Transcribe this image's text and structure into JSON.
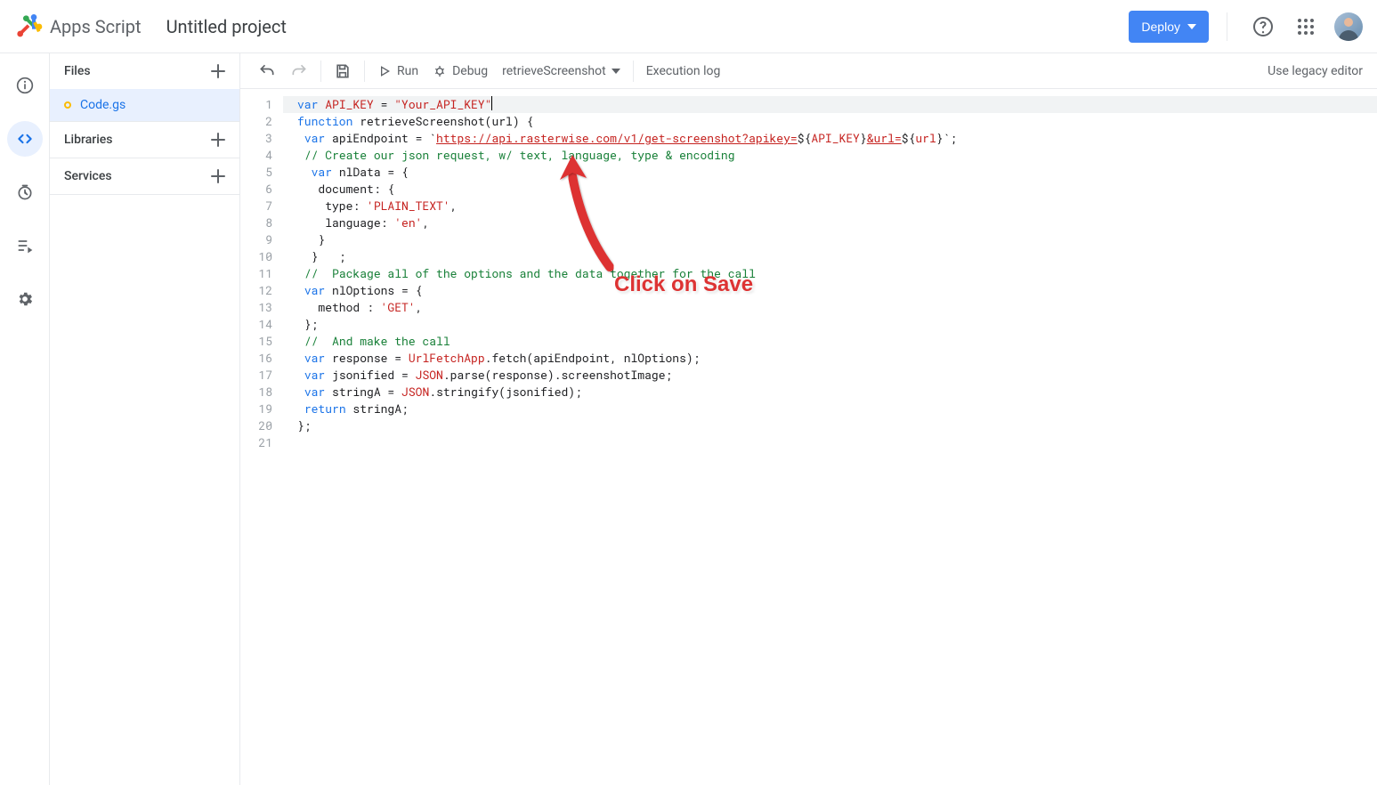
{
  "header": {
    "brand": "Apps Script",
    "project_title": "Untitled project",
    "deploy_label": "Deploy"
  },
  "sidebar": {
    "files_label": "Files",
    "libraries_label": "Libraries",
    "services_label": "Services",
    "file_name": "Code.gs"
  },
  "toolbar": {
    "run_label": "Run",
    "debug_label": "Debug",
    "function_selected": "retrieveScreenshot",
    "execution_log_label": "Execution log",
    "legacy_label": "Use legacy editor"
  },
  "annotation": {
    "text": "Click on Save"
  },
  "code": {
    "lines": [
      {
        "n": 1,
        "segs": [
          {
            "t": "kw",
            "v": "var"
          },
          {
            "t": "",
            "v": " "
          },
          {
            "t": "tvar",
            "v": "API_KEY"
          },
          {
            "t": "",
            "v": " = "
          },
          {
            "t": "str",
            "v": "\"Your_API_KEY\""
          }
        ]
      },
      {
        "n": 2,
        "segs": [
          {
            "t": "kw",
            "v": "function"
          },
          {
            "t": "",
            "v": " retrieveScreenshot(url) {"
          }
        ]
      },
      {
        "n": 3,
        "segs": [
          {
            "t": "",
            "v": " "
          },
          {
            "t": "kw",
            "v": "var"
          },
          {
            "t": "",
            "v": " apiEndpoint = `"
          },
          {
            "t": "url",
            "v": "https://api.rasterwise.com/v1/get-screenshot?apikey="
          },
          {
            "t": "",
            "v": "${"
          },
          {
            "t": "tvar",
            "v": "API_KEY"
          },
          {
            "t": "",
            "v": "}"
          },
          {
            "t": "url",
            "v": "&url="
          },
          {
            "t": "",
            "v": "${"
          },
          {
            "t": "tvar",
            "v": "url"
          },
          {
            "t": "",
            "v": "}"
          },
          {
            "t": "",
            "v": "`;"
          }
        ]
      },
      {
        "n": 4,
        "segs": [
          {
            "t": "",
            "v": " "
          },
          {
            "t": "cmt",
            "v": "// Create our json request, w/ text, language, type & encoding"
          }
        ]
      },
      {
        "n": 5,
        "segs": [
          {
            "t": "",
            "v": "  "
          },
          {
            "t": "kw",
            "v": "var"
          },
          {
            "t": "",
            "v": " nlData = {"
          }
        ]
      },
      {
        "n": 6,
        "segs": [
          {
            "t": "",
            "v": "   document: {"
          }
        ]
      },
      {
        "n": 7,
        "segs": [
          {
            "t": "",
            "v": "    type: "
          },
          {
            "t": "str",
            "v": "'PLAIN_TEXT'"
          },
          {
            "t": "",
            "v": ","
          }
        ]
      },
      {
        "n": 8,
        "segs": [
          {
            "t": "",
            "v": "    language: "
          },
          {
            "t": "str",
            "v": "'en'"
          },
          {
            "t": "",
            "v": ","
          }
        ]
      },
      {
        "n": 9,
        "segs": [
          {
            "t": "",
            "v": "   }"
          }
        ]
      },
      {
        "n": 10,
        "segs": [
          {
            "t": "",
            "v": "  }   ;"
          }
        ]
      },
      {
        "n": 11,
        "segs": [
          {
            "t": "",
            "v": " "
          },
          {
            "t": "cmt",
            "v": "//  Package all of the options and the data together for the call"
          }
        ]
      },
      {
        "n": 12,
        "segs": [
          {
            "t": "",
            "v": " "
          },
          {
            "t": "kw",
            "v": "var"
          },
          {
            "t": "",
            "v": " nlOptions = {"
          }
        ]
      },
      {
        "n": 13,
        "segs": [
          {
            "t": "",
            "v": "   method : "
          },
          {
            "t": "str",
            "v": "'GET'"
          },
          {
            "t": "",
            "v": ","
          }
        ]
      },
      {
        "n": 14,
        "segs": [
          {
            "t": "",
            "v": " };"
          }
        ]
      },
      {
        "n": 15,
        "segs": [
          {
            "t": "",
            "v": ""
          }
        ]
      },
      {
        "n": 16,
        "segs": [
          {
            "t": "",
            "v": " "
          },
          {
            "t": "cmt",
            "v": "//  And make the call"
          }
        ]
      },
      {
        "n": 17,
        "segs": [
          {
            "t": "",
            "v": " "
          },
          {
            "t": "kw",
            "v": "var"
          },
          {
            "t": "",
            "v": " response = "
          },
          {
            "t": "cls",
            "v": "UrlFetchApp"
          },
          {
            "t": "",
            "v": ".fetch(apiEndpoint, nlOptions);"
          }
        ]
      },
      {
        "n": 18,
        "segs": [
          {
            "t": "",
            "v": " "
          },
          {
            "t": "kw",
            "v": "var"
          },
          {
            "t": "",
            "v": " jsonified = "
          },
          {
            "t": "cls",
            "v": "JSON"
          },
          {
            "t": "",
            "v": ".parse(response).screenshotImage;"
          }
        ]
      },
      {
        "n": 19,
        "segs": [
          {
            "t": "",
            "v": " "
          },
          {
            "t": "kw",
            "v": "var"
          },
          {
            "t": "",
            "v": " stringA = "
          },
          {
            "t": "cls",
            "v": "JSON"
          },
          {
            "t": "",
            "v": ".stringify(jsonified);"
          }
        ]
      },
      {
        "n": 20,
        "segs": [
          {
            "t": "",
            "v": " "
          },
          {
            "t": "kw",
            "v": "return"
          },
          {
            "t": "",
            "v": " stringA;"
          }
        ]
      },
      {
        "n": 21,
        "segs": [
          {
            "t": "",
            "v": "};"
          }
        ]
      }
    ]
  }
}
